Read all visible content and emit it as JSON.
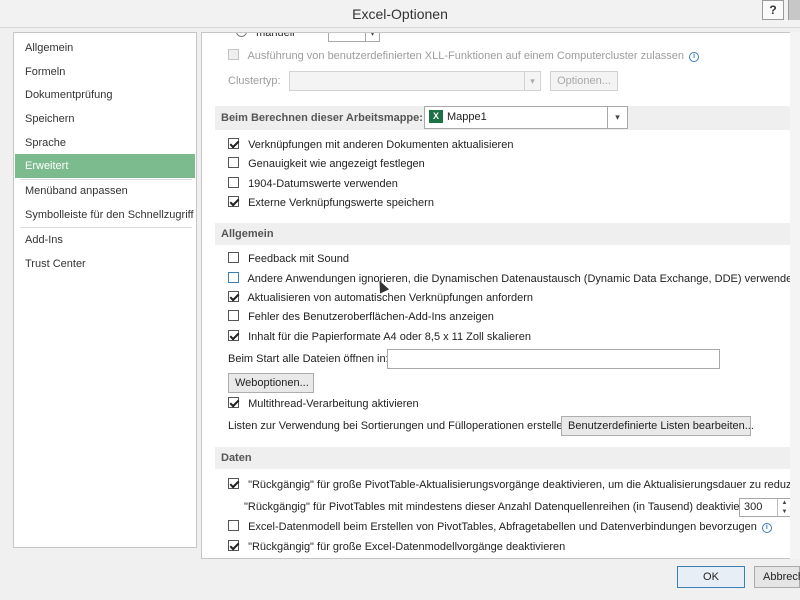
{
  "window": {
    "title": "Excel-Optionen",
    "help_label": "?"
  },
  "sidebar": {
    "items": [
      {
        "label": "Allgemein"
      },
      {
        "label": "Formeln"
      },
      {
        "label": "Dokumentprüfung"
      },
      {
        "label": "Speichern"
      },
      {
        "label": "Sprache"
      },
      {
        "label": "Erweitert",
        "selected": true
      },
      {
        "label": "Menüband anpassen"
      },
      {
        "label": "Symbolleiste für den Schnellzugriff"
      },
      {
        "label": "Add-Ins"
      },
      {
        "label": "Trust Center"
      }
    ]
  },
  "top_partial": {
    "radio_label": "manuell",
    "xll_label": "Ausführung von benutzerdefinierten XLL-Funktionen auf einem Computercluster zulassen",
    "clustertyp_label": "Clustertyp:",
    "optionen_label": "Optionen..."
  },
  "calc_section": {
    "label": "Beim Berechnen dieser Arbeitsmappe:",
    "workbook": "Mappe1",
    "xl_icon_text": "X",
    "options": [
      {
        "label": "Verknüpfungen mit anderen Dokumenten aktualisieren",
        "checked": true
      },
      {
        "label": "Genauigkeit wie angezeigt festlegen",
        "checked": false
      },
      {
        "label": "1904-Datumswerte verwenden",
        "checked": false
      },
      {
        "label": "Externe Verknüpfungswerte speichern",
        "checked": true
      }
    ]
  },
  "general_section": {
    "header": "Allgemein",
    "options": [
      {
        "label": "Feedback mit Sound",
        "checked": false
      },
      {
        "label": "Andere Anwendungen ignorieren, die Dynamischen Datenaustausch (Dynamic Data Exchange, DDE) verwenden",
        "checked": false
      },
      {
        "label": "Aktualisieren von automatischen Verknüpfungen anfordern",
        "checked": true
      },
      {
        "label": "Fehler des Benutzeroberflächen-Add-Ins anzeigen",
        "checked": false
      },
      {
        "label": "Inhalt für die Papierformate A4 oder 8,5 x 11 Zoll skalieren",
        "checked": true
      }
    ],
    "startup_label": "Beim Start alle Dateien öffnen in:",
    "startup_value": "",
    "weboptionen_label": "Weboptionen...",
    "multithread_label": "Multithread-Verarbeitung aktivieren",
    "multithread_checked": true,
    "lists_label": "Listen zur Verwendung bei Sortierungen und Fülloperationen erstellen:",
    "lists_button": "Benutzerdefinierte Listen bearbeiten..."
  },
  "data_section": {
    "header": "Daten",
    "undo_pivot_label": "\"Rückgängig\" für große PivotTable-Aktualisierungsvorgänge deaktivieren, um die Aktualisierungsdauer zu reduzieren",
    "undo_pivot_checked": true,
    "rows_label": "\"Rückgängig\" für PivotTables mit mindestens dieser Anzahl Datenquellenreihen (in Tausend) deaktivieren:",
    "rows_value": "300",
    "datamodel_label": "Excel-Datenmodell beim Erstellen von PivotTables, Abfragetabellen und Datenverbindungen bevorzugen",
    "datamodel_checked": false,
    "undo_datamodel_label": "\"Rückgängig\" für große Excel-Datenmodellvorgänge deaktivieren",
    "undo_datamodel_checked": true
  },
  "footer": {
    "ok_label": "OK",
    "cancel_label": "Abbrechen"
  }
}
